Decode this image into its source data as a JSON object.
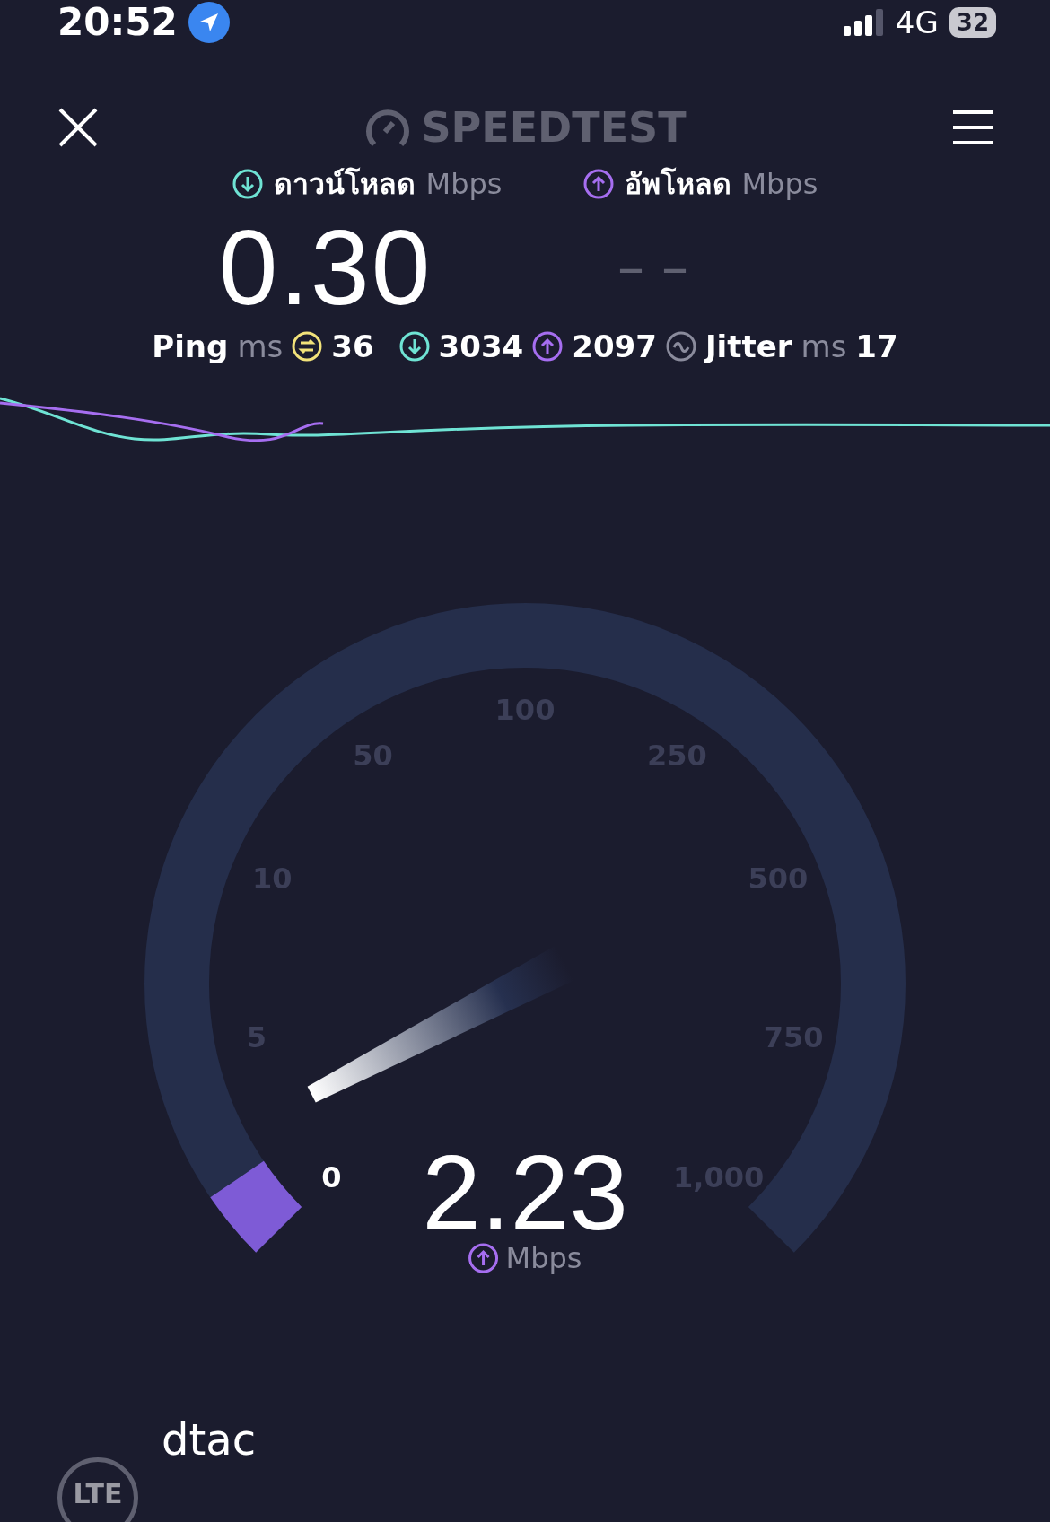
{
  "status_bar": {
    "time": "20:52",
    "network": "4G",
    "battery": "32"
  },
  "header": {
    "logo": "SPEEDTEST"
  },
  "download": {
    "label": "ดาวน์โหลด",
    "unit": "Mbps",
    "value": "0.30"
  },
  "upload": {
    "label": "อัพโหลด",
    "unit": "Mbps",
    "value": "– –"
  },
  "stats": [
    {
      "kind": "ping",
      "label": "Ping",
      "unit": "ms",
      "value": "36"
    },
    {
      "kind": "down",
      "value": "3034"
    },
    {
      "kind": "up",
      "value": "2097"
    },
    {
      "kind": "jitter",
      "label": "Jitter",
      "unit": "ms",
      "value": "17"
    }
  ],
  "gauge": {
    "value": "2.23",
    "unit": "Mbps",
    "ticks": [
      {
        "label": "0",
        "passed": true
      },
      {
        "label": "5",
        "passed": false
      },
      {
        "label": "10",
        "passed": false
      },
      {
        "label": "50",
        "passed": false
      },
      {
        "label": "100",
        "passed": false
      },
      {
        "label": "250",
        "passed": false
      },
      {
        "label": "500",
        "passed": false
      },
      {
        "label": "750",
        "passed": false
      },
      {
        "label": "1,000",
        "passed": false
      }
    ]
  },
  "provider": {
    "name": "dtac",
    "badge": "LTE"
  }
}
